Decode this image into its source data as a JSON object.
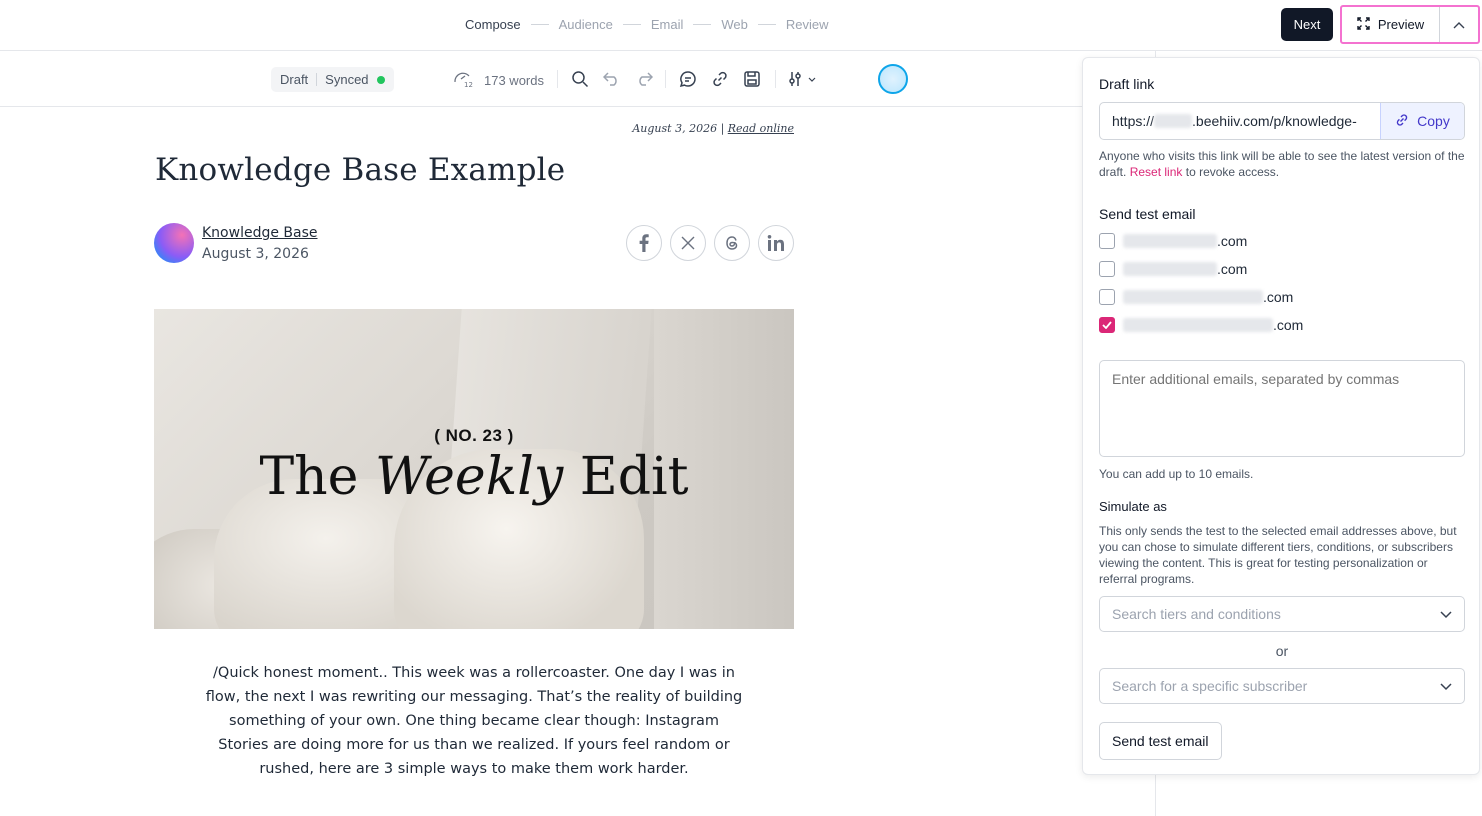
{
  "steps": [
    "Compose",
    "Audience",
    "Email",
    "Web",
    "Review"
  ],
  "header": {
    "next_label": "Next",
    "preview_label": "Preview"
  },
  "toolbar": {
    "status_draft": "Draft",
    "status_synced": "Synced",
    "word_count": "173 words"
  },
  "article": {
    "date": "August 3, 2026",
    "read_online": "Read online",
    "title": "Knowledge Base Example",
    "author_name": "Knowledge Base",
    "author_date": "August 3, 2026",
    "hero_subtitle": "( NO. 23 )",
    "hero_title_pre": "The",
    "hero_title_em": "Weekly",
    "hero_title_post": "Edit",
    "body": "/Quick honest moment.. This week was a rollercoaster. One day I was in flow, the next I was rewriting our messaging. That’s the reality of building something of your own. One thing became clear though: Instagram Stories are doing more for us than we realized. If yours feel random or rushed, here are 3 simple ways to make them work harder."
  },
  "panel": {
    "draft_link_label": "Draft link",
    "link_prefix": "https://",
    "link_suffix": ".beehiiv.com/p/knowledge-",
    "copy_label": "Copy",
    "link_help_pre": "Anyone who visits this link will be able to see the latest version of the draft.",
    "reset_link": "Reset link",
    "link_help_post": "to revoke access.",
    "send_test_label": "Send test email",
    "emails": [
      {
        "suffix": ".com",
        "checked": false
      },
      {
        "suffix": ".com",
        "checked": false
      },
      {
        "suffix": ".com",
        "checked": false
      },
      {
        "suffix": ".com",
        "checked": true
      }
    ],
    "additional_placeholder": "Enter additional emails, separated by commas",
    "emails_limit_help": "You can add up to 10 emails.",
    "simulate_label": "Simulate as",
    "simulate_help": "This only sends the test to the selected email addresses above, but you can chose to simulate different tiers, conditions, or subscribers viewing the content. This is great for testing personalization or referral programs.",
    "tiers_placeholder": "Search tiers and conditions",
    "or_label": "or",
    "subscriber_placeholder": "Search for a specific subscriber",
    "send_button": "Send test email"
  },
  "colors": {
    "accent_pink": "#db2777",
    "highlight_border": "#f472d0",
    "synced_dot": "#22c55e",
    "copy_text": "#4338ca"
  }
}
